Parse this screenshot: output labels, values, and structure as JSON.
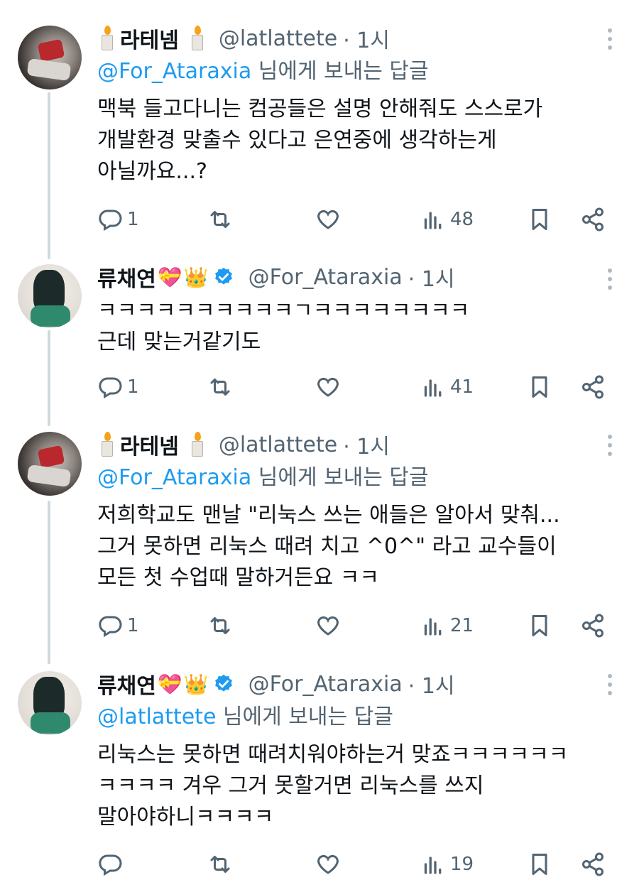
{
  "tweets": [
    {
      "name": "라테넴",
      "handle": "@latlattete",
      "time": "· 1시",
      "reply_to_mention": "@For_Ataraxia",
      "reply_to_suffix": " 님에게 보내는 답글",
      "text": "맥북 들고다니는 컴공들은 설명 안해줘도 스스로가\n개발환경 맞출수 있다고 은연중에 생각하는게\n아닐까요...?",
      "replies": "1",
      "views": "48"
    },
    {
      "name": "류채연",
      "handle": "@For_Ataraxia",
      "time": "· 1시",
      "text": "ㅋㅋㅋㅋㅋㅋㅋㅋㅋㅋㄱㅋㅋㅋㅋㅋㅋㅋㅋ\n근데 맞는거같기도",
      "replies": "1",
      "views": "41"
    },
    {
      "name": "라테넴",
      "handle": "@latlattete",
      "time": "· 1시",
      "reply_to_mention": "@For_Ataraxia",
      "reply_to_suffix": " 님에게 보내는 답글",
      "text": "저희학교도 맨날 \"리눅스 쓰는 애들은 알아서 맞춰...\n그거 못하면 리눅스 때려 치고 ^0^\" 라고 교수들이\n모든 첫 수업때 말하거든요 ㅋㅋ",
      "replies": "1",
      "views": "21"
    },
    {
      "name": "류채연",
      "handle": "@For_Ataraxia",
      "time": "· 1시",
      "reply_to_mention": "@latlattete",
      "reply_to_suffix": " 님에게 보내는 답글",
      "text": "리눅스는 못하면 때려치워야하는거 맞죠ㅋㅋㅋㅋㅋㅋ\nㅋㅋㅋㅋ 겨우 그거 못할거면 리눅스를 쓰지\n말아야하니ㅋㅋㅋㅋ",
      "replies": "",
      "views": "19"
    }
  ],
  "icons": {
    "reply": "reply-icon",
    "retweet": "retweet-icon",
    "like": "heart-icon",
    "views": "views-icon",
    "bookmark": "bookmark-icon",
    "share": "share-icon",
    "more": "more-icon",
    "verified": "verified-badge-icon"
  },
  "colors": {
    "link": "#1d9bf0",
    "muted": "#536471",
    "thread_line": "#cfd9de"
  }
}
